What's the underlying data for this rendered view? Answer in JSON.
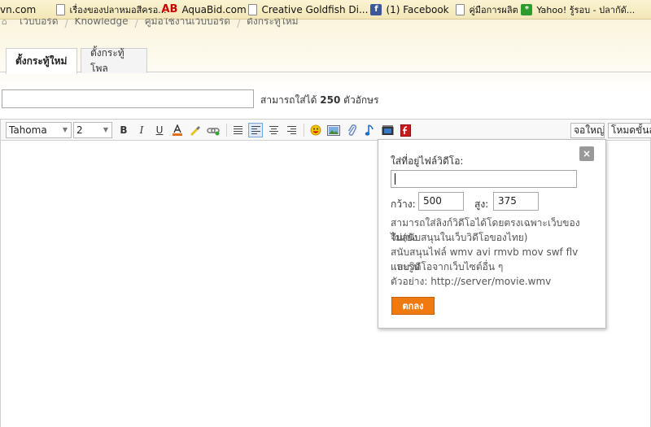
{
  "bookmarks": [
    {
      "label": "vn.com",
      "icon": "none"
    },
    {
      "label": "เรื่องของปลาหมอสีครอ...",
      "icon": "page-icon"
    },
    {
      "label": "AquaBid.com",
      "icon": "aquabid-icon"
    },
    {
      "label": "Creative Goldfish Di...",
      "icon": "page-icon"
    },
    {
      "label": "(1) Facebook",
      "icon": "facebook-icon"
    },
    {
      "label": "คู่มือการผลิต",
      "icon": "page-icon"
    },
    {
      "label": "Yahoo! รู้รอบ - ปลากัดั...",
      "icon": "yahoo-icon"
    }
  ],
  "bookmark_icon_text": {
    "aquabid": "AB",
    "facebook": "f",
    "yahoo": "*"
  },
  "breadcrumb": [
    "เว็บบอร์ด",
    "Knowledge",
    "คู่มือใช้งานเว็บบอร์ด",
    "ตั้งกระทู้ใหม่"
  ],
  "breadcrumb_sep": "/",
  "tabs": [
    {
      "label": "ตั้งกระทู้ใหม่",
      "active": true
    },
    {
      "label": "ตั้งกระทู้โพล",
      "active": false
    }
  ],
  "subject": {
    "value": "",
    "hint_prefix": "สามารถใส่ได้",
    "hint_count": "250",
    "hint_suffix": "ตัวอักษร"
  },
  "toolbar": {
    "font_family": "Tahoma",
    "font_size": "2",
    "bold": "B",
    "italic": "I",
    "underline": "U",
    "fullscreen_label": "จอใหญ่",
    "advanced_label": "โหมดขั้นสูง"
  },
  "video_popup": {
    "close": "×",
    "title": "ใส่ที่อยู่ไฟล์วิดีโอ:",
    "url_value": "",
    "width_label": "กว้าง:",
    "width_value": "500",
    "height_label": "สูง:",
    "height_value": "375",
    "note1_line1": "สามารถใส่ลิงก์วิดีโอได้โดยตรงเฉพาะเว็บของจีน(ยัง",
    "note1_line2": "ไม่สนับสนุนในเว็บวิดีโอของไทย)",
    "note2_line1": "สนับสนุนไฟล์ wmv avi rmvb mov swf flv และรูป",
    "note2_line2": "แบบวิดีโอจากเว็บไซต์อื่น ๆ",
    "example": "ตัวอย่าง: http://server/movie.wmv",
    "ok_label": "ตกลง"
  },
  "colors": {
    "accent": "#ef7a10",
    "bookmark_bar": "#f3e7b8"
  }
}
